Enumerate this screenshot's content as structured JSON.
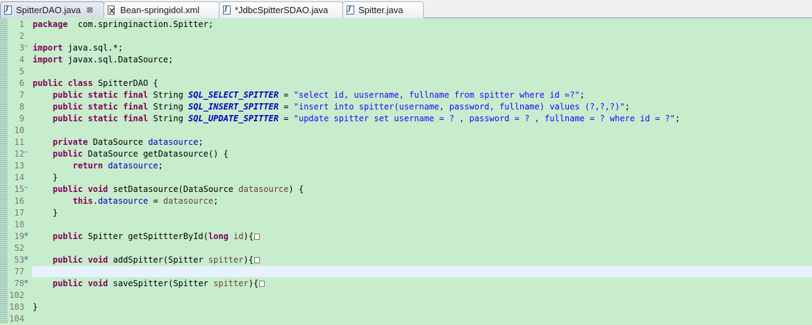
{
  "tabs": [
    {
      "label": "SpitterDAO.java",
      "icon": "java-file-icon",
      "active": true,
      "close": "⊠"
    },
    {
      "label": "Bean-springidol.xml",
      "icon": "xml-file-icon",
      "active": false
    },
    {
      "label": "*JdbcSpitterSDAO.java",
      "icon": "java-file-icon",
      "active": false
    },
    {
      "label": "Spitter.java",
      "icon": "java-file-icon",
      "active": false
    }
  ],
  "editor": {
    "current_line": "77",
    "lines": [
      {
        "n": "1",
        "tokens": [
          [
            "kw",
            "package"
          ],
          [
            "",
            "  com.springinaction.Spitter;"
          ]
        ]
      },
      {
        "n": "2",
        "tokens": []
      },
      {
        "n": "3",
        "fold": "−",
        "tokens": [
          [
            "kw",
            "import"
          ],
          [
            "",
            " java.sql.*;"
          ]
        ]
      },
      {
        "n": "4",
        "tokens": [
          [
            "kw",
            "import"
          ],
          [
            "",
            " javax.sql.DataSource;"
          ]
        ]
      },
      {
        "n": "5",
        "tokens": []
      },
      {
        "n": "6",
        "tokens": [
          [
            "kw",
            "public"
          ],
          [
            "",
            " "
          ],
          [
            "kw",
            "class"
          ],
          [
            "",
            " SpitterDAO {"
          ]
        ]
      },
      {
        "n": "7",
        "tokens": [
          [
            "",
            "    "
          ],
          [
            "kw",
            "public"
          ],
          [
            "",
            " "
          ],
          [
            "kw",
            "static"
          ],
          [
            "",
            " "
          ],
          [
            "kw",
            "final"
          ],
          [
            "",
            " String "
          ],
          [
            "cst",
            "SQL_SELECT_SPITTER"
          ],
          [
            "",
            " = "
          ],
          [
            "str",
            "\"select id, uusername, fullname from spitter where id =?\""
          ],
          [
            "",
            ";"
          ]
        ]
      },
      {
        "n": "8",
        "tokens": [
          [
            "",
            "    "
          ],
          [
            "kw",
            "public"
          ],
          [
            "",
            " "
          ],
          [
            "kw",
            "static"
          ],
          [
            "",
            " "
          ],
          [
            "kw",
            "final"
          ],
          [
            "",
            " String "
          ],
          [
            "cst",
            "SQL_INSERT_SPITTER"
          ],
          [
            "",
            " = "
          ],
          [
            "str",
            "\"insert into spitter(username, password, fullname) values (?,?,?)\""
          ],
          [
            "",
            ";"
          ]
        ]
      },
      {
        "n": "9",
        "tokens": [
          [
            "",
            "    "
          ],
          [
            "kw",
            "public"
          ],
          [
            "",
            " "
          ],
          [
            "kw",
            "static"
          ],
          [
            "",
            " "
          ],
          [
            "kw",
            "final"
          ],
          [
            "",
            " String "
          ],
          [
            "cst",
            "SQL_UPDATE_SPITTER"
          ],
          [
            "",
            " = "
          ],
          [
            "str",
            "\"update spitter set username = ? , password = ? , fullname = ? where id = ?\""
          ],
          [
            "",
            ";"
          ]
        ]
      },
      {
        "n": "10",
        "tokens": []
      },
      {
        "n": "11",
        "tokens": [
          [
            "",
            "    "
          ],
          [
            "kw",
            "private"
          ],
          [
            "",
            " DataSource "
          ],
          [
            "fld",
            "datasource"
          ],
          [
            "",
            ";"
          ]
        ]
      },
      {
        "n": "12",
        "fold": "−",
        "tokens": [
          [
            "",
            "    "
          ],
          [
            "kw",
            "public"
          ],
          [
            "",
            " DataSource getDatasource() {"
          ]
        ]
      },
      {
        "n": "13",
        "tokens": [
          [
            "",
            "        "
          ],
          [
            "kw",
            "return"
          ],
          [
            "",
            " "
          ],
          [
            "fld",
            "datasource"
          ],
          [
            "",
            ";"
          ]
        ]
      },
      {
        "n": "14",
        "tokens": [
          [
            "",
            "    }"
          ]
        ]
      },
      {
        "n": "15",
        "fold": "−",
        "tokens": [
          [
            "",
            "    "
          ],
          [
            "kw",
            "public"
          ],
          [
            "",
            " "
          ],
          [
            "kw",
            "void"
          ],
          [
            "",
            " setDatasource(DataSource "
          ],
          [
            "prm",
            "datasource"
          ],
          [
            "",
            ") {"
          ]
        ]
      },
      {
        "n": "16",
        "tokens": [
          [
            "",
            "        "
          ],
          [
            "kw",
            "this"
          ],
          [
            "",
            "."
          ],
          [
            "fld",
            "datasource"
          ],
          [
            "",
            " = "
          ],
          [
            "prm",
            "datasource"
          ],
          [
            "",
            ";"
          ]
        ]
      },
      {
        "n": "17",
        "tokens": [
          [
            "",
            "    }"
          ]
        ]
      },
      {
        "n": "18",
        "tokens": []
      },
      {
        "n": "19",
        "fold": "⊕",
        "tokens": [
          [
            "",
            "    "
          ],
          [
            "kw",
            "public"
          ],
          [
            "",
            " Spitter getSpittterById("
          ],
          [
            "kw",
            "long"
          ],
          [
            "",
            " "
          ],
          [
            "prm",
            "id"
          ],
          [
            "",
            "){"
          ],
          [
            "box",
            ""
          ]
        ]
      },
      {
        "n": "52",
        "tokens": []
      },
      {
        "n": "53",
        "fold": "⊕",
        "tokens": [
          [
            "",
            "    "
          ],
          [
            "kw",
            "public"
          ],
          [
            "",
            " "
          ],
          [
            "kw",
            "void"
          ],
          [
            "",
            " addSpitter(Spitter "
          ],
          [
            "prm",
            "spitter"
          ],
          [
            "",
            "){"
          ],
          [
            "box",
            ""
          ]
        ]
      },
      {
        "n": "77",
        "tokens": []
      },
      {
        "n": "78",
        "fold": "⊕",
        "tokens": [
          [
            "",
            "    "
          ],
          [
            "kw",
            "public"
          ],
          [
            "",
            " "
          ],
          [
            "kw",
            "void"
          ],
          [
            "",
            " saveSpitter(Spitter "
          ],
          [
            "prm",
            "spitter"
          ],
          [
            "",
            "){"
          ],
          [
            "box",
            ""
          ]
        ]
      },
      {
        "n": "102",
        "tokens": []
      },
      {
        "n": "103",
        "tokens": [
          [
            "",
            "}"
          ]
        ]
      },
      {
        "n": "104",
        "tokens": []
      }
    ]
  }
}
